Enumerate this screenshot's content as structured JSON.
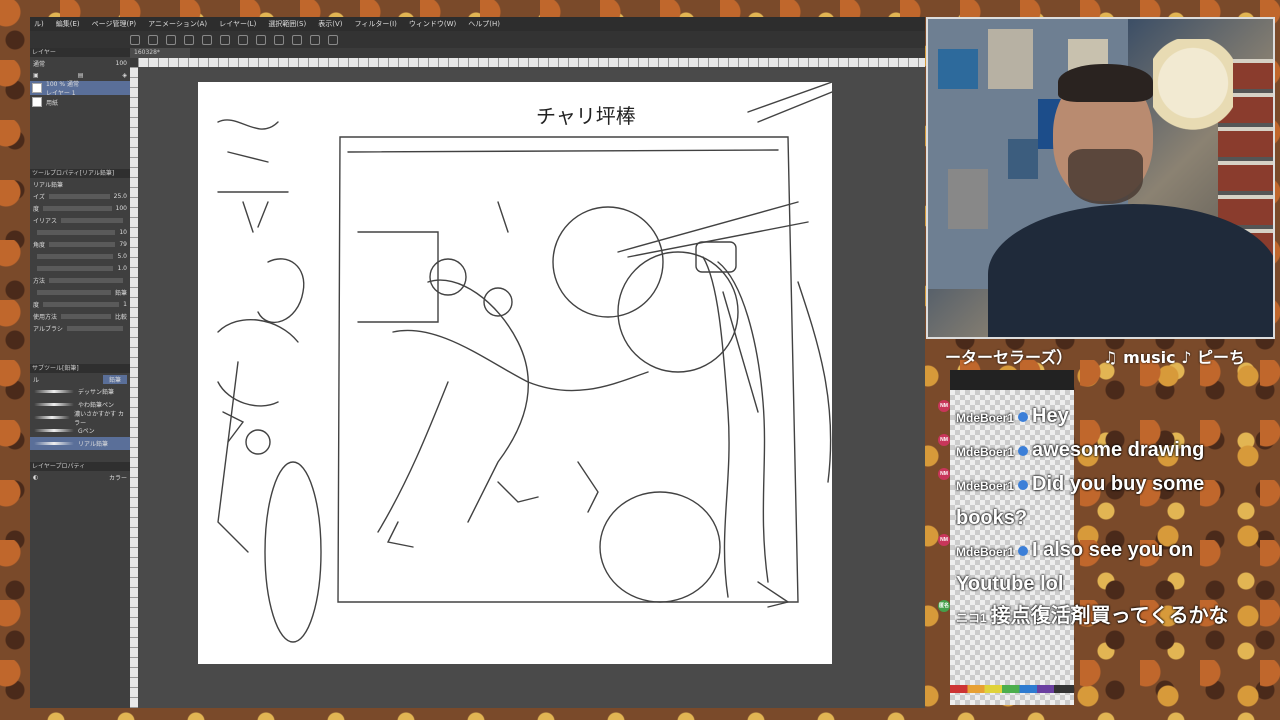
{
  "menubar": {
    "items": [
      "ル)",
      "編集(E)",
      "ページ管理(P)",
      "アニメーション(A)",
      "レイヤー(L)",
      "選択範囲(S)",
      "表示(V)",
      "フィルター(I)",
      "ウィンドウ(W)",
      "ヘルプ(H)"
    ]
  },
  "document": {
    "tab_label": "160328*"
  },
  "canvas": {
    "title": "チャリ坪棒"
  },
  "layer_panel": {
    "header": "レイヤー",
    "blend_mode": "通常",
    "opacity": "100",
    "layers": [
      {
        "name": "100 % 通常",
        "sub": "レイヤー 1",
        "selected": true
      },
      {
        "name": "用紙",
        "selected": false
      }
    ]
  },
  "tool_property": {
    "header": "ツールプロパティ[リアル鉛筆]",
    "sub_tool": "リアル鉛筆",
    "props": [
      {
        "label": "イズ",
        "value": "25.0"
      },
      {
        "label": "度",
        "value": "100"
      },
      {
        "label": "イリアス",
        "value": ""
      },
      {
        "label": "",
        "value": "10"
      },
      {
        "label": "角度",
        "value": "79"
      },
      {
        "label": "",
        "value": "5.0"
      },
      {
        "label": "",
        "value": "1.0"
      },
      {
        "label": "方法",
        "value": ""
      },
      {
        "label": "",
        "value": "鉛筆"
      },
      {
        "label": "度",
        "value": "1"
      },
      {
        "label": "使用方法",
        "value": "比較"
      },
      {
        "label": "アルブラシ",
        "value": ""
      }
    ]
  },
  "subtool_panel": {
    "header": "サブツール[鉛筆]",
    "tabs": [
      "ル",
      "鉛筆"
    ],
    "brushes": [
      "デッサン鉛筆",
      "やわ鉛筆ペン",
      "濃いさかすかす カラー",
      "Gペン",
      "リアル鉛筆"
    ]
  },
  "bottom_panel": {
    "header": "レイヤープロパティ",
    "color_label": "カラー"
  },
  "ticker": {
    "left": "ーターセラーズ）",
    "right": "♫ music ♪ ピーち"
  },
  "chat": [
    {
      "user": "MdeBoer1",
      "icon": "NM",
      "text": "Hey",
      "badge": true
    },
    {
      "user": "MdeBoer1",
      "icon": "NM",
      "text": "awesome drawing",
      "badge": true
    },
    {
      "user": "MdeBoer1",
      "icon": "NM",
      "text": "Did you buy some books?",
      "badge": true
    },
    {
      "user": "MdeBoer1",
      "icon": "NM",
      "text": "I also see you on Youtube lol",
      "badge": true
    },
    {
      "user": "ニコ1",
      "icon": "匿名",
      "text": "接点復活剤買ってくるかな",
      "badge": false
    }
  ]
}
